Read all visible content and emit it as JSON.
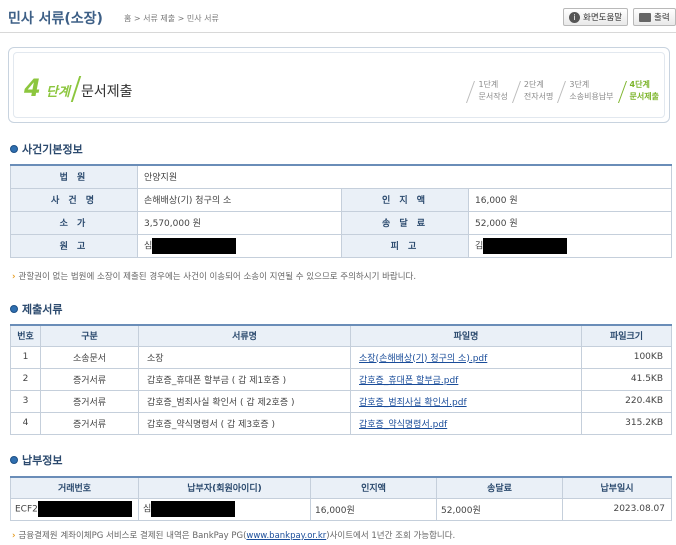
{
  "header": {
    "title": "민사 서류(소장)",
    "breadcrumb": "홈 > 서류 제출 > 민사 서류",
    "help_label": "화면도움말",
    "print_label": "출력"
  },
  "steps": {
    "current_num": "4",
    "current_unit": "단계",
    "current_name": "문서제출",
    "items": [
      {
        "line1": "1단계",
        "line2": "문서작성"
      },
      {
        "line1": "2단계",
        "line2": "전자서명"
      },
      {
        "line1": "3단계",
        "line2": "소송비용납부"
      },
      {
        "line1": "4단계",
        "line2": "문서제출"
      }
    ]
  },
  "case_info": {
    "section_title": "사건기본정보",
    "court_label": "법 원",
    "court_value": "안양지원",
    "case_name_label": "사 건 명",
    "case_name_value": "손해배상(기) 청구의 소",
    "stamp_label": "인 지 액",
    "stamp_value": "16,000 원",
    "claim_label": "소 가",
    "claim_value": "3,570,000 원",
    "delivery_label": "송 달 료",
    "delivery_value": "52,000 원",
    "plaintiff_label": "원 고",
    "plaintiff_value": "심",
    "defendant_label": "피 고",
    "defendant_value": "김",
    "note": "관할권이 없는 법원에 소장이 제출된 경우에는 사건이 이송되어 소송이 지연될 수 있으므로 주의하시기 바랍니다."
  },
  "documents": {
    "section_title": "제출서류",
    "headers": [
      "번호",
      "구분",
      "서류명",
      "파일명",
      "파일크기"
    ],
    "rows": [
      {
        "no": "1",
        "type": "소송문서",
        "name": "소장",
        "file": "소장(손해배상(기) 청구의 소).pdf",
        "size": "100KB"
      },
      {
        "no": "2",
        "type": "증거서류",
        "name": "갑호증_휴대폰 할부금 ( 갑 제1호증 )",
        "file": "갑호증_휴대폰 할부금.pdf",
        "size": "41.5KB"
      },
      {
        "no": "3",
        "type": "증거서류",
        "name": "갑호증_범죄사실 확인서 ( 갑 제2호증 )",
        "file": "갑호증_범죄사실 확인서.pdf",
        "size": "220.4KB"
      },
      {
        "no": "4",
        "type": "증거서류",
        "name": "갑호증_약식명령서 ( 갑 제3호증 )",
        "file": "갑호증_약식명령서.pdf",
        "size": "315.2KB"
      }
    ]
  },
  "payment": {
    "section_title": "납부정보",
    "headers": [
      "거래번호",
      "납부자(회원아이디)",
      "인지액",
      "송달료",
      "납부일시"
    ],
    "row": {
      "txn": "ECF2",
      "payer": "심",
      "stamp": "16,000원",
      "delivery": "52,000원",
      "date": "2023.08.07"
    },
    "note_prefix": "금융결제원 계좌이체PG 서비스로 결제된 내역은 BankPay PG(",
    "note_link": "www.bankpay.or.kr",
    "note_suffix": ")사이트에서 1년간 조회 가능합니다."
  }
}
